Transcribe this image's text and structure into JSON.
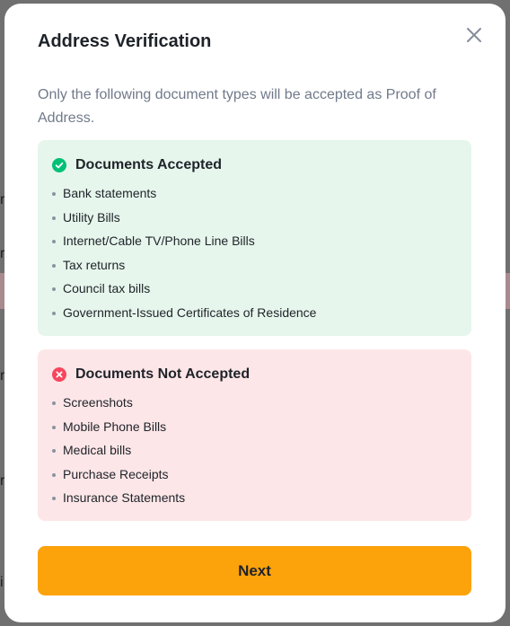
{
  "modal": {
    "title": "Address Verification",
    "intro": "Only the following document types will be accepted as Proof of Address.",
    "next_label": "Next"
  },
  "accepted": {
    "title": "Documents Accepted",
    "color": "#02c076",
    "items": [
      "Bank statements",
      "Utility Bills",
      "Internet/Cable TV/Phone Line Bills",
      "Tax returns",
      "Council tax bills",
      "Government-Issued Certificates of Residence"
    ]
  },
  "rejected": {
    "title": "Documents Not Accepted",
    "color": "#f6465d",
    "items": [
      "Screenshots",
      "Mobile Phone Bills",
      "Medical bills",
      "Purchase Receipts",
      "Insurance Statements"
    ]
  },
  "icons": {
    "close": "close-icon",
    "accepted": "check-circle-icon",
    "rejected": "x-circle-icon"
  },
  "colors": {
    "primary_button": "#fca20b",
    "accepted_bg": "#e6f6ec",
    "rejected_bg": "#fde6e8"
  }
}
